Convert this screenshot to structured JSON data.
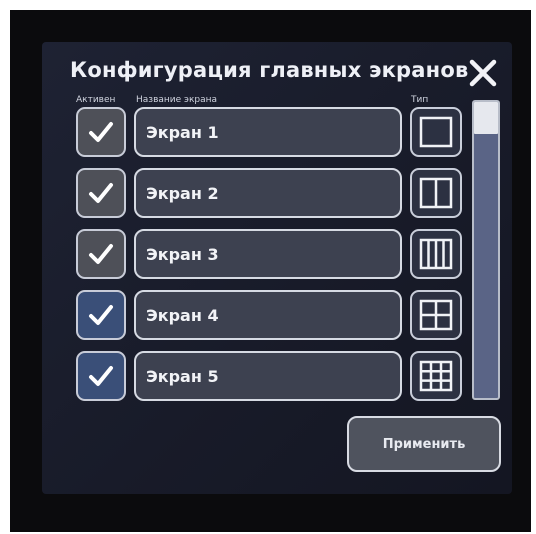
{
  "dialog": {
    "title": "Конфигурация главных экранов",
    "close_icon": "close-icon"
  },
  "columns": {
    "active": "Активен",
    "name": "Название экрана",
    "type": "Тип"
  },
  "rows": [
    {
      "active": true,
      "name": "Экран 1",
      "layout": "single-pane-icon"
    },
    {
      "active": true,
      "name": "Экран 2",
      "layout": "two-column-icon"
    },
    {
      "active": true,
      "name": "Экран 3",
      "layout": "three-column-icon"
    },
    {
      "active": true,
      "name": "Экран 4",
      "layout": "two-by-two-grid-icon"
    },
    {
      "active": true,
      "name": "Экран 5",
      "layout": "three-by-three-grid-icon"
    }
  ],
  "apply_button": "Применить",
  "colors": {
    "background": "#181b29",
    "checkbox_gray": "#4e5058",
    "checkbox_blue": "#3a4f78",
    "scrollbar": "#5a6486"
  }
}
